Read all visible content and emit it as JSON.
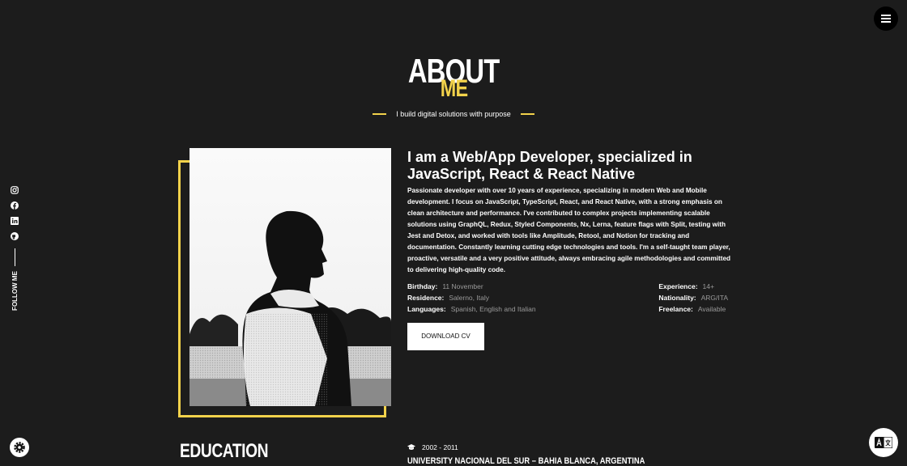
{
  "heading": {
    "title": "ABOUT",
    "subtitle": "ME",
    "tagline": "I build digital solutions with purpose"
  },
  "social": {
    "icons": [
      "instagram-icon",
      "facebook-icon",
      "linkedin-icon",
      "github-icon"
    ],
    "follow_label": "FOLLOW ME"
  },
  "about": {
    "headline": "I am a Web/App Developer, specialized in JavaScript, React & React Native",
    "bio": "Passionate developer with over 10 years of experience, specializing in modern Web and Mobile development. I focus on JavaScript, TypeScript, React, and React Native, with a strong emphasis on clean architecture and performance. I've contributed to complex projects implementing scalable solutions using GraphQL, Redux, Styled Components, Nx, Lerna, feature flags with Split, testing with Jest and Detox, and worked with tools like Amplitude, Retool, and Notion for tracking and documentation. Constantly learning cutting edge technologies and tools. I'm a self-taught team player, proactive, versatile and a very positive attitude, always embracing agile methodologies and committed to delivering high-quality code.",
    "info_left": [
      {
        "label": "Birthday:",
        "value": "11 November"
      },
      {
        "label": "Residence:",
        "value": "Salerno, Italy"
      },
      {
        "label": "Languages:",
        "value": "Spanish, English and Italian"
      }
    ],
    "info_right": [
      {
        "label": "Experience:",
        "value": "14+"
      },
      {
        "label": "Nationality:",
        "value": "ARG/ITA"
      },
      {
        "label": "Freelance:",
        "value": "Available"
      }
    ],
    "download_label": "DOWNLOAD CV"
  },
  "education": {
    "title": "EDUCATION",
    "entry": {
      "years": "2002 - 2011",
      "school": "UNIVERSITY NACIONAL DEL SUR",
      "location": "BAHIA BLANCA, ARGENTINA"
    }
  },
  "colors": {
    "accent": "#f2d24b",
    "background": "#1c1c1c"
  }
}
